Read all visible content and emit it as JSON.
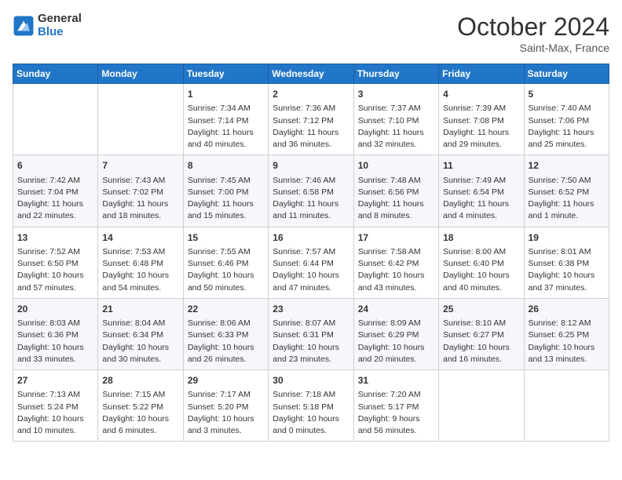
{
  "logo": {
    "general": "General",
    "blue": "Blue"
  },
  "header": {
    "month": "October 2024",
    "location": "Saint-Max, France"
  },
  "columns": [
    "Sunday",
    "Monday",
    "Tuesday",
    "Wednesday",
    "Thursday",
    "Friday",
    "Saturday"
  ],
  "weeks": [
    [
      {
        "day": "",
        "sunrise": "",
        "sunset": "",
        "daylight": ""
      },
      {
        "day": "",
        "sunrise": "",
        "sunset": "",
        "daylight": ""
      },
      {
        "day": "1",
        "sunrise": "Sunrise: 7:34 AM",
        "sunset": "Sunset: 7:14 PM",
        "daylight": "Daylight: 11 hours and 40 minutes."
      },
      {
        "day": "2",
        "sunrise": "Sunrise: 7:36 AM",
        "sunset": "Sunset: 7:12 PM",
        "daylight": "Daylight: 11 hours and 36 minutes."
      },
      {
        "day": "3",
        "sunrise": "Sunrise: 7:37 AM",
        "sunset": "Sunset: 7:10 PM",
        "daylight": "Daylight: 11 hours and 32 minutes."
      },
      {
        "day": "4",
        "sunrise": "Sunrise: 7:39 AM",
        "sunset": "Sunset: 7:08 PM",
        "daylight": "Daylight: 11 hours and 29 minutes."
      },
      {
        "day": "5",
        "sunrise": "Sunrise: 7:40 AM",
        "sunset": "Sunset: 7:06 PM",
        "daylight": "Daylight: 11 hours and 25 minutes."
      }
    ],
    [
      {
        "day": "6",
        "sunrise": "Sunrise: 7:42 AM",
        "sunset": "Sunset: 7:04 PM",
        "daylight": "Daylight: 11 hours and 22 minutes."
      },
      {
        "day": "7",
        "sunrise": "Sunrise: 7:43 AM",
        "sunset": "Sunset: 7:02 PM",
        "daylight": "Daylight: 11 hours and 18 minutes."
      },
      {
        "day": "8",
        "sunrise": "Sunrise: 7:45 AM",
        "sunset": "Sunset: 7:00 PM",
        "daylight": "Daylight: 11 hours and 15 minutes."
      },
      {
        "day": "9",
        "sunrise": "Sunrise: 7:46 AM",
        "sunset": "Sunset: 6:58 PM",
        "daylight": "Daylight: 11 hours and 11 minutes."
      },
      {
        "day": "10",
        "sunrise": "Sunrise: 7:48 AM",
        "sunset": "Sunset: 6:56 PM",
        "daylight": "Daylight: 11 hours and 8 minutes."
      },
      {
        "day": "11",
        "sunrise": "Sunrise: 7:49 AM",
        "sunset": "Sunset: 6:54 PM",
        "daylight": "Daylight: 11 hours and 4 minutes."
      },
      {
        "day": "12",
        "sunrise": "Sunrise: 7:50 AM",
        "sunset": "Sunset: 6:52 PM",
        "daylight": "Daylight: 11 hours and 1 minute."
      }
    ],
    [
      {
        "day": "13",
        "sunrise": "Sunrise: 7:52 AM",
        "sunset": "Sunset: 6:50 PM",
        "daylight": "Daylight: 10 hours and 57 minutes."
      },
      {
        "day": "14",
        "sunrise": "Sunrise: 7:53 AM",
        "sunset": "Sunset: 6:48 PM",
        "daylight": "Daylight: 10 hours and 54 minutes."
      },
      {
        "day": "15",
        "sunrise": "Sunrise: 7:55 AM",
        "sunset": "Sunset: 6:46 PM",
        "daylight": "Daylight: 10 hours and 50 minutes."
      },
      {
        "day": "16",
        "sunrise": "Sunrise: 7:57 AM",
        "sunset": "Sunset: 6:44 PM",
        "daylight": "Daylight: 10 hours and 47 minutes."
      },
      {
        "day": "17",
        "sunrise": "Sunrise: 7:58 AM",
        "sunset": "Sunset: 6:42 PM",
        "daylight": "Daylight: 10 hours and 43 minutes."
      },
      {
        "day": "18",
        "sunrise": "Sunrise: 8:00 AM",
        "sunset": "Sunset: 6:40 PM",
        "daylight": "Daylight: 10 hours and 40 minutes."
      },
      {
        "day": "19",
        "sunrise": "Sunrise: 8:01 AM",
        "sunset": "Sunset: 6:38 PM",
        "daylight": "Daylight: 10 hours and 37 minutes."
      }
    ],
    [
      {
        "day": "20",
        "sunrise": "Sunrise: 8:03 AM",
        "sunset": "Sunset: 6:36 PM",
        "daylight": "Daylight: 10 hours and 33 minutes."
      },
      {
        "day": "21",
        "sunrise": "Sunrise: 8:04 AM",
        "sunset": "Sunset: 6:34 PM",
        "daylight": "Daylight: 10 hours and 30 minutes."
      },
      {
        "day": "22",
        "sunrise": "Sunrise: 8:06 AM",
        "sunset": "Sunset: 6:33 PM",
        "daylight": "Daylight: 10 hours and 26 minutes."
      },
      {
        "day": "23",
        "sunrise": "Sunrise: 8:07 AM",
        "sunset": "Sunset: 6:31 PM",
        "daylight": "Daylight: 10 hours and 23 minutes."
      },
      {
        "day": "24",
        "sunrise": "Sunrise: 8:09 AM",
        "sunset": "Sunset: 6:29 PM",
        "daylight": "Daylight: 10 hours and 20 minutes."
      },
      {
        "day": "25",
        "sunrise": "Sunrise: 8:10 AM",
        "sunset": "Sunset: 6:27 PM",
        "daylight": "Daylight: 10 hours and 16 minutes."
      },
      {
        "day": "26",
        "sunrise": "Sunrise: 8:12 AM",
        "sunset": "Sunset: 6:25 PM",
        "daylight": "Daylight: 10 hours and 13 minutes."
      }
    ],
    [
      {
        "day": "27",
        "sunrise": "Sunrise: 7:13 AM",
        "sunset": "Sunset: 5:24 PM",
        "daylight": "Daylight: 10 hours and 10 minutes."
      },
      {
        "day": "28",
        "sunrise": "Sunrise: 7:15 AM",
        "sunset": "Sunset: 5:22 PM",
        "daylight": "Daylight: 10 hours and 6 minutes."
      },
      {
        "day": "29",
        "sunrise": "Sunrise: 7:17 AM",
        "sunset": "Sunset: 5:20 PM",
        "daylight": "Daylight: 10 hours and 3 minutes."
      },
      {
        "day": "30",
        "sunrise": "Sunrise: 7:18 AM",
        "sunset": "Sunset: 5:18 PM",
        "daylight": "Daylight: 10 hours and 0 minutes."
      },
      {
        "day": "31",
        "sunrise": "Sunrise: 7:20 AM",
        "sunset": "Sunset: 5:17 PM",
        "daylight": "Daylight: 9 hours and 56 minutes."
      },
      {
        "day": "",
        "sunrise": "",
        "sunset": "",
        "daylight": ""
      },
      {
        "day": "",
        "sunrise": "",
        "sunset": "",
        "daylight": ""
      }
    ]
  ]
}
